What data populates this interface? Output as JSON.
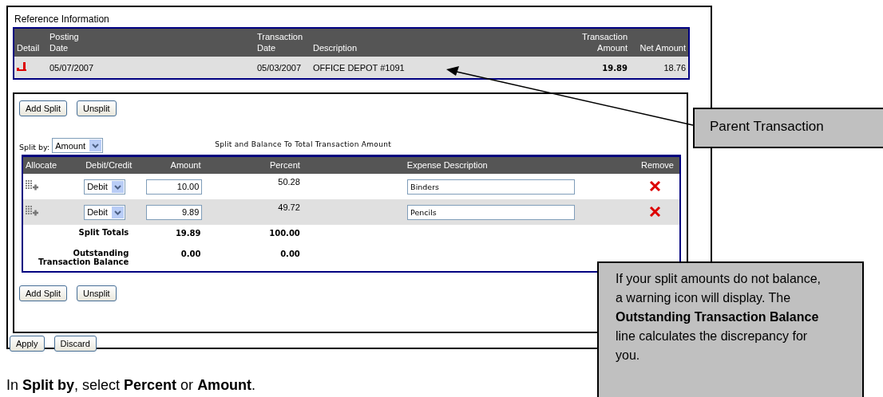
{
  "reference": {
    "title": "Reference Information",
    "columns": [
      "Detail",
      "Posting Date",
      "Transaction Date",
      "Description",
      "Transaction Amount",
      "Net Amount"
    ],
    "row": {
      "posting_date": "05/07/2007",
      "transaction_date": "05/03/2007",
      "description": "OFFICE DEPOT #1091",
      "transaction_amount": "19.89",
      "net_amount": "18.76"
    }
  },
  "split": {
    "top_buttons": [
      "Add Split",
      "Unsplit"
    ],
    "split_by_label": "Split by:",
    "split_by_value": "Amount",
    "balance_note": "Split and Balance To  Total Transaction Amount",
    "columns": [
      "Allocate",
      "Debit/Credit",
      "Amount",
      "Percent",
      "Expense Description",
      "Remove"
    ],
    "rows": [
      {
        "type": "Debit",
        "amount": "10.00",
        "percent": "50.28",
        "description": "Binders"
      },
      {
        "type": "Debit",
        "amount": "9.89",
        "percent": "49.72",
        "description": "Pencils"
      }
    ],
    "totals": [
      {
        "label": "Split Totals",
        "amount": "19.89",
        "percent": "100.00"
      },
      {
        "label": "Outstanding Transaction Balance",
        "amount": "0.00",
        "percent": "0.00"
      }
    ],
    "bottom_buttons": [
      "Add Split",
      "Unsplit"
    ]
  },
  "actions": [
    "Apply",
    "Discard"
  ],
  "callouts": [
    {
      "text": "Parent Transaction"
    },
    {
      "text": "If your split amounts do not balance, a warning icon will display. The **Outstanding Transaction Balance** line calculates the discrepancy for you."
    }
  ],
  "instruction": "In **Split by**, select **Percent** or **Amount**."
}
